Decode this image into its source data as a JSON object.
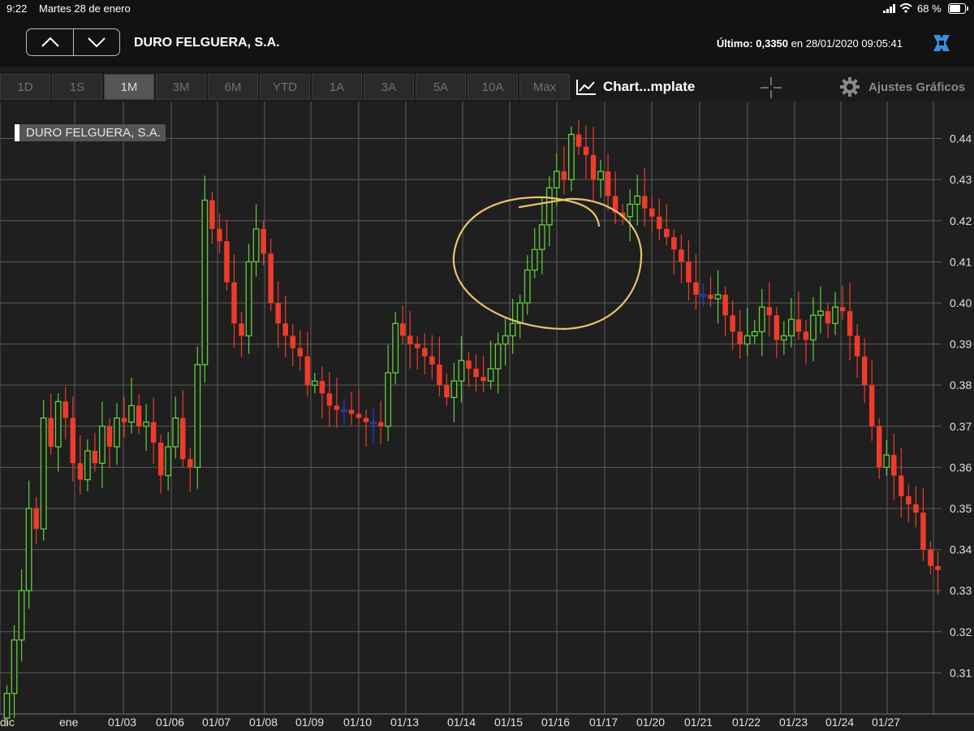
{
  "status_bar": {
    "time": "9:22",
    "date": "Martes 28 de enero",
    "battery": "68 %"
  },
  "header": {
    "title": "DURO FELGUERA, S.A.",
    "last_label": "Último:",
    "last_value": "0,3350",
    "last_suffix": "en 28/01/2020 09:05:41"
  },
  "toolbar": {
    "periods": [
      "1D",
      "1S",
      "1M",
      "3M",
      "6M",
      "YTD",
      "1A",
      "3A",
      "5A",
      "10A",
      "Max"
    ],
    "active_period": "1M",
    "template_label": "Chart...mplate",
    "settings_label": "Ajustes Gráficos"
  },
  "colors": {
    "up": "#5fcf3a",
    "down": "#ee3b2b",
    "neutral": "#2b3ecf",
    "grid": "#5c5c5c",
    "annotation": "#e9c36b",
    "brand": "#3d8ee0"
  },
  "chart_data": {
    "type": "candlestick",
    "legend": "DURO FELGUERA, S.A.",
    "ylim": [
      0.3,
      0.449
    ],
    "y_ticks": [
      "0.31",
      "0.32",
      "0.33",
      "0.34",
      "0.35",
      "0.36",
      "0.37",
      "0.38",
      "0.39",
      "0.40",
      "0.41",
      "0.42",
      "0.43",
      "0.44"
    ],
    "x_labels": [
      "dic",
      "ene",
      "01/03",
      "01/06",
      "01/07",
      "01/08",
      "01/09",
      "01/10",
      "01/13",
      "01/14",
      "01/15",
      "01/16",
      "01/17",
      "01/20",
      "01/21",
      "01/22",
      "01/23",
      "01/24",
      "01/27"
    ],
    "close_series": [
      0.305,
      0.318,
      0.33,
      0.35,
      0.345,
      0.372,
      0.365,
      0.376,
      0.372,
      0.361,
      0.357,
      0.364,
      0.361,
      0.37,
      0.365,
      0.372,
      0.371,
      0.375,
      0.37,
      0.371,
      0.366,
      0.358,
      0.365,
      0.372,
      0.362,
      0.36,
      0.385,
      0.425,
      0.418,
      0.415,
      0.405,
      0.395,
      0.392,
      0.41,
      0.418,
      0.412,
      0.4,
      0.395,
      0.392,
      0.389,
      0.387,
      0.38,
      0.381,
      0.378,
      0.375,
      0.374,
      0.374,
      0.373,
      0.372,
      0.371,
      0.371,
      0.37,
      0.383,
      0.395,
      0.392,
      0.39,
      0.389,
      0.387,
      0.385,
      0.38,
      0.377,
      0.381,
      0.386,
      0.384,
      0.382,
      0.381,
      0.384,
      0.39,
      0.392,
      0.395,
      0.4,
      0.408,
      0.413,
      0.419,
      0.428,
      0.432,
      0.43,
      0.441,
      0.438,
      0.436,
      0.43,
      0.432,
      0.426,
      0.422,
      0.421,
      0.424,
      0.426,
      0.423,
      0.421,
      0.418,
      0.416,
      0.413,
      0.41,
      0.405,
      0.402,
      0.402,
      0.401,
      0.402,
      0.397,
      0.393,
      0.39,
      0.392,
      0.393,
      0.399,
      0.397,
      0.391,
      0.392,
      0.396,
      0.393,
      0.391,
      0.397,
      0.398,
      0.395,
      0.399,
      0.398,
      0.392,
      0.387,
      0.38,
      0.37,
      0.36,
      0.363,
      0.358,
      0.353,
      0.351,
      0.349,
      0.34,
      0.336,
      0.335
    ],
    "annotation": "freehand circle around the 01/15–01/16 peak"
  }
}
